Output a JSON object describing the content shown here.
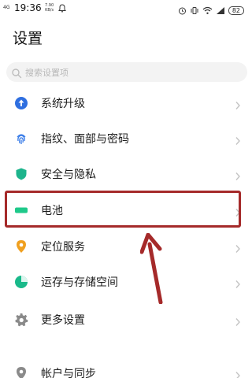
{
  "status_bar": {
    "network": "4G",
    "time": "19:36",
    "speed_value": "7.90",
    "speed_unit": "KB/s",
    "battery": "82"
  },
  "page": {
    "title": "设置"
  },
  "search": {
    "placeholder": "搜索设置项"
  },
  "settings": {
    "items": [
      {
        "label": "系统升级",
        "icon": "system-update-icon",
        "color": "#2f6fe0"
      },
      {
        "label": "指纹、面部与密码",
        "icon": "fingerprint-icon",
        "color": "#3a7de8"
      },
      {
        "label": "安全与隐私",
        "icon": "shield-icon",
        "color": "#1db48c"
      },
      {
        "label": "电池",
        "icon": "battery-icon",
        "color": "#1ec98a"
      },
      {
        "label": "定位服务",
        "icon": "location-pin-icon",
        "color": "#f0a020"
      },
      {
        "label": "运存与存储空间",
        "icon": "storage-pie-icon",
        "color": "#19b98a"
      },
      {
        "label": "更多设置",
        "icon": "gear-icon",
        "color": "#8a8a8a"
      },
      {
        "label": "帐户与同步",
        "icon": "account-sync-icon",
        "color": "#8a8a8a"
      }
    ]
  },
  "annotation": {
    "highlight_color": "#a52a2a",
    "highlighted_item": "电池"
  }
}
